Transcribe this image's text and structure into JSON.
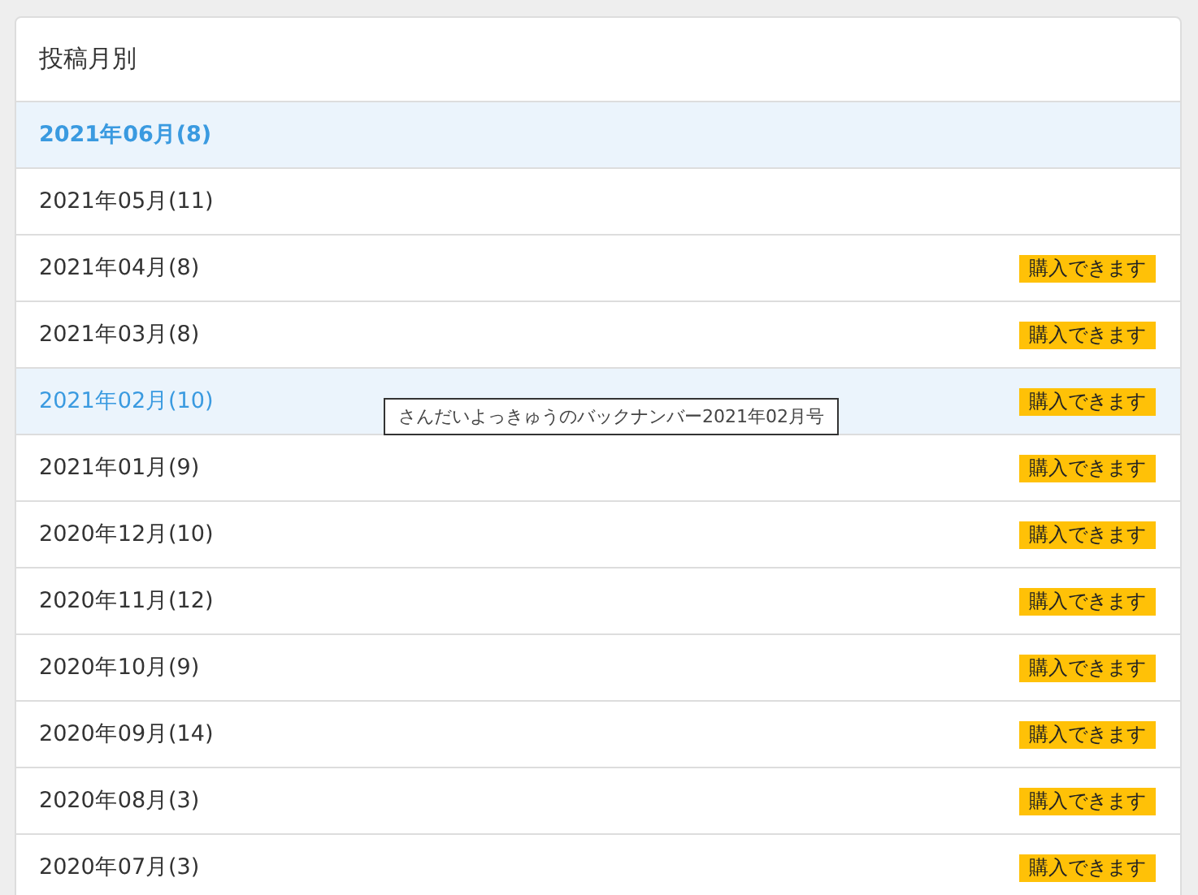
{
  "panel": {
    "title": "投稿月別"
  },
  "months": [
    {
      "label": "2021年06月(8)",
      "selected": true,
      "hovered": false
    },
    {
      "label": "2021年05月(11)",
      "selected": false,
      "hovered": false
    },
    {
      "label": "2021年04月(8)",
      "selected": false,
      "hovered": false,
      "badge": "購入できます"
    },
    {
      "label": "2021年03月(8)",
      "selected": false,
      "hovered": false,
      "badge": "購入できます"
    },
    {
      "label": "2021年02月(10)",
      "selected": false,
      "hovered": true,
      "badge": "購入できます",
      "tooltip": "さんだいよっきゅうのバックナンバー2021年02月号"
    },
    {
      "label": "2021年01月(9)",
      "selected": false,
      "hovered": false,
      "badge": "購入できます"
    },
    {
      "label": "2020年12月(10)",
      "selected": false,
      "hovered": false,
      "badge": "購入できます"
    },
    {
      "label": "2020年11月(12)",
      "selected": false,
      "hovered": false,
      "badge": "購入できます"
    },
    {
      "label": "2020年10月(9)",
      "selected": false,
      "hovered": false,
      "badge": "購入できます"
    },
    {
      "label": "2020年09月(14)",
      "selected": false,
      "hovered": false,
      "badge": "購入できます"
    },
    {
      "label": "2020年08月(3)",
      "selected": false,
      "hovered": false,
      "badge": "購入できます"
    },
    {
      "label": "2020年07月(3)",
      "selected": false,
      "hovered": false,
      "badge": "購入できます"
    }
  ]
}
